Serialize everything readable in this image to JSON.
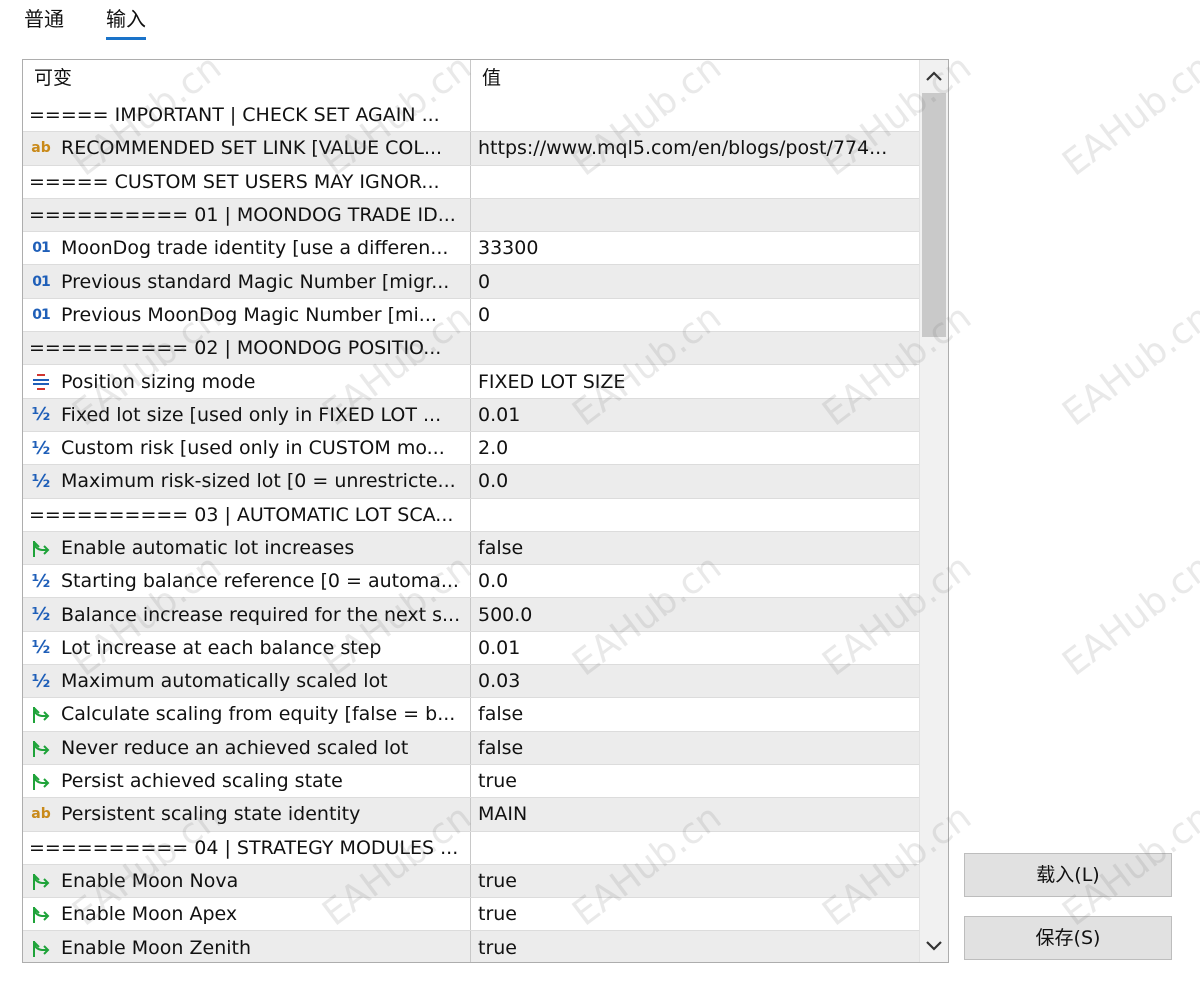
{
  "tabs": [
    {
      "label": "普通"
    },
    {
      "label": "输入"
    }
  ],
  "table": {
    "header": {
      "variable": "可变",
      "value": "值"
    },
    "rows": [
      {
        "icon": "none",
        "name": "===== IMPORTANT | CHECK SET AGAIN ...",
        "value": ""
      },
      {
        "icon": "string-icon",
        "icon_text": "ab",
        "name": "RECOMMENDED SET LINK [VALUE COL...",
        "value": "https://www.mql5.com/en/blogs/post/774..."
      },
      {
        "icon": "none",
        "name": "===== CUSTOM SET USERS MAY IGNOR...",
        "value": ""
      },
      {
        "icon": "none",
        "name": "========== 01 | MOONDOG TRADE ID...",
        "value": ""
      },
      {
        "icon": "integer-icon",
        "icon_text": "01",
        "name": "MoonDog trade identity [use a differen...",
        "value": "33300"
      },
      {
        "icon": "integer-icon",
        "icon_text": "01",
        "name": "Previous standard Magic Number [migr...",
        "value": "0"
      },
      {
        "icon": "integer-icon",
        "icon_text": "01",
        "name": "Previous MoonDog Magic Number [mi...",
        "value": "0"
      },
      {
        "icon": "none",
        "name": "========== 02 | MOONDOG POSITIO...",
        "value": ""
      },
      {
        "icon": "enum-icon",
        "name": "Position sizing mode",
        "value": "FIXED LOT SIZE"
      },
      {
        "icon": "double-icon",
        "icon_text": "½",
        "name": "Fixed lot size [used only in FIXED LOT ...",
        "value": "0.01"
      },
      {
        "icon": "double-icon",
        "icon_text": "½",
        "name": "Custom risk [used only in CUSTOM mo...",
        "value": "2.0"
      },
      {
        "icon": "double-icon",
        "icon_text": "½",
        "name": "Maximum risk-sized lot [0 = unrestricte...",
        "value": "0.0"
      },
      {
        "icon": "none",
        "name": "========== 03 | AUTOMATIC LOT SCA...",
        "value": ""
      },
      {
        "icon": "bool-icon",
        "name": "Enable automatic lot increases",
        "value": "false"
      },
      {
        "icon": "double-icon",
        "icon_text": "½",
        "name": "Starting balance reference [0 = automa...",
        "value": "0.0"
      },
      {
        "icon": "double-icon",
        "icon_text": "½",
        "name": "Balance increase required for the next s...",
        "value": "500.0"
      },
      {
        "icon": "double-icon",
        "icon_text": "½",
        "name": "Lot increase at each balance step",
        "value": "0.01"
      },
      {
        "icon": "double-icon",
        "icon_text": "½",
        "name": "Maximum automatically scaled lot",
        "value": "0.03"
      },
      {
        "icon": "bool-icon",
        "name": "Calculate scaling from equity [false = b...",
        "value": "false"
      },
      {
        "icon": "bool-icon",
        "name": "Never reduce an achieved scaled lot",
        "value": "false"
      },
      {
        "icon": "bool-icon",
        "name": "Persist achieved scaling state",
        "value": "true"
      },
      {
        "icon": "string-icon",
        "icon_text": "ab",
        "name": "Persistent scaling state identity",
        "value": "MAIN"
      },
      {
        "icon": "none",
        "name": "========== 04 | STRATEGY MODULES ...",
        "value": ""
      },
      {
        "icon": "bool-icon",
        "name": "Enable Moon Nova",
        "value": "true"
      },
      {
        "icon": "bool-icon",
        "name": "Enable Moon Apex",
        "value": "true"
      },
      {
        "icon": "bool-icon",
        "name": "Enable Moon Zenith",
        "value": "true"
      }
    ]
  },
  "buttons": {
    "load": "载入(L)",
    "save": "保存(S)"
  },
  "watermark": "EAHub.cn",
  "colors": {
    "accent": "#1a73c9",
    "bool_icon": "#1fa33a",
    "num_icon": "#1f5fb8",
    "string_icon": "#c98a1a",
    "enum_icon": "#d0352f"
  }
}
